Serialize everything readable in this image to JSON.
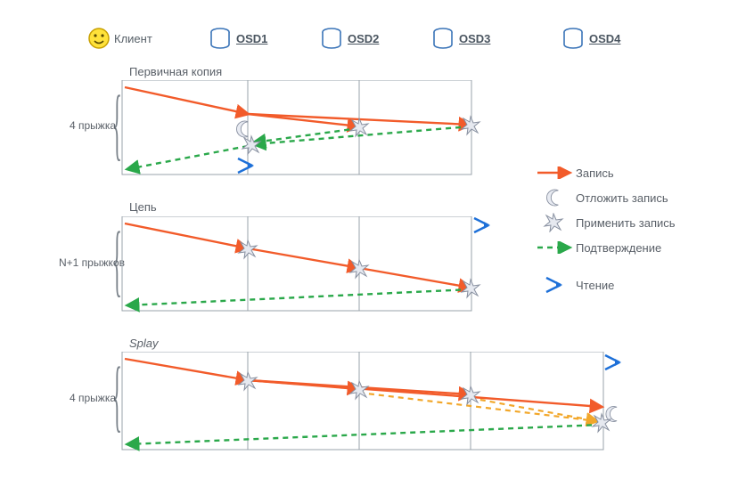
{
  "header": {
    "client": "Клиент",
    "osd1": "OSD1",
    "osd2": "OSD2",
    "osd3": "OSD3",
    "osd4": "OSD4"
  },
  "blocks": {
    "primary": {
      "title": "Первичная копия",
      "side": "4 прыжка"
    },
    "chain": {
      "title": "Цепь",
      "side": "N+1 прыжков"
    },
    "splay": {
      "title": "Splay",
      "side": "4 прыжка"
    }
  },
  "legend": {
    "write": "Запись",
    "delay": "Отложить запись",
    "apply": "Применить запись",
    "ack": "Подтверждение",
    "read": "Чтение"
  },
  "icons": {
    "client": "smiley-icon",
    "osd": "cylinder-icon",
    "write_arrow": "red-arrow-icon",
    "delay": "moon-icon",
    "apply": "burst-icon",
    "ack": "green-dash-arrow-icon",
    "read": "blue-read-icon"
  },
  "colors": {
    "write": "#f25b2a",
    "ack": "#2aa84a",
    "read": "#1e70d8",
    "delay_alt": "#f2a72a",
    "grid": "#9aa3ab"
  },
  "chart_data": {
    "type": "table",
    "title": "Replication schemes: write/ack flow across OSDs",
    "actors": [
      "Client",
      "OSD1",
      "OSD2",
      "OSD3",
      "OSD4"
    ],
    "schemes": [
      {
        "name": "Первичная копия",
        "hops_label": "4 прыжка",
        "writes": [
          [
            "Client",
            "OSD1"
          ],
          [
            "OSD1",
            "OSD2"
          ],
          [
            "OSD1",
            "OSD3"
          ]
        ],
        "acks": [
          [
            "OSD3",
            "OSD1"
          ],
          [
            "OSD2",
            "OSD1"
          ],
          [
            "OSD1",
            "Client"
          ]
        ],
        "apply": [
          "OSD1",
          "OSD2",
          "OSD3"
        ],
        "delay": [
          "OSD1"
        ],
        "read_at": [
          "OSD1"
        ]
      },
      {
        "name": "Цепь",
        "hops_label": "N+1 прыжков",
        "writes": [
          [
            "Client",
            "OSD1"
          ],
          [
            "OSD1",
            "OSD2"
          ],
          [
            "OSD2",
            "OSD3"
          ]
        ],
        "acks": [
          [
            "OSD3",
            "Client"
          ]
        ],
        "apply": [
          "OSD1",
          "OSD2",
          "OSD3"
        ],
        "read_at": [
          "OSD3"
        ]
      },
      {
        "name": "Splay",
        "hops_label": "4 прыжка",
        "writes": [
          [
            "Client",
            "OSD1"
          ],
          [
            "OSD1",
            "OSD2"
          ],
          [
            "OSD1",
            "OSD3"
          ],
          [
            "OSD1",
            "OSD4"
          ]
        ],
        "delayed_acks": [
          [
            "OSD2",
            "OSD4"
          ],
          [
            "OSD3",
            "OSD4"
          ]
        ],
        "acks": [
          [
            "OSD4",
            "Client"
          ]
        ],
        "apply": [
          "OSD1",
          "OSD2",
          "OSD3",
          "OSD4"
        ],
        "delay": [
          "OSD4"
        ],
        "read_at": [
          "OSD4"
        ]
      }
    ]
  }
}
